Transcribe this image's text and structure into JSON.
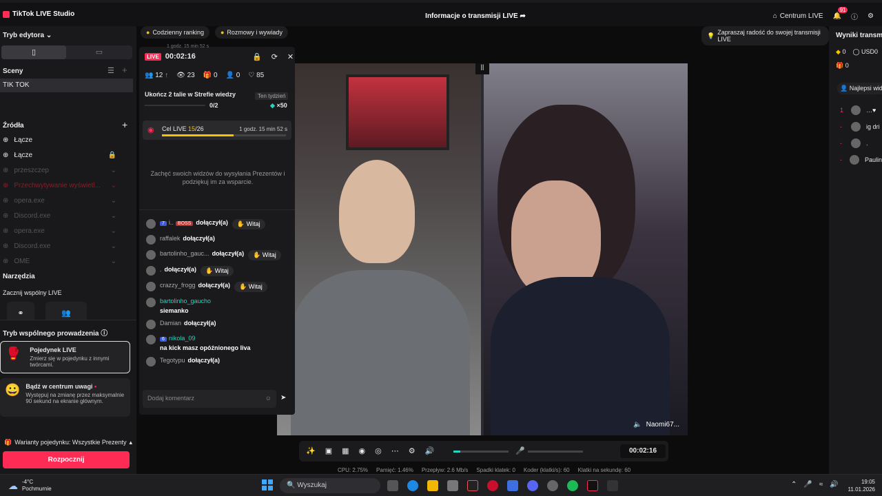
{
  "app": {
    "title": "TikTok LIVE Studio",
    "window_title": "Informacje o transmisji LIVE",
    "center_label": "Centrum LIVE",
    "notif_count": "91"
  },
  "left": {
    "mode_label": "Tryb edytora",
    "scenes_label": "Sceny",
    "scene": "TIK TOK",
    "sources_label": "Źródła",
    "sources": [
      {
        "label": "Łącze",
        "style": "on"
      },
      {
        "label": "Łącze",
        "style": "on"
      },
      {
        "label": "przeszczep",
        "style": "dim"
      },
      {
        "label": "Przechwytywanie wyświetl...",
        "style": "red"
      },
      {
        "label": "opera.exe",
        "style": "dim"
      },
      {
        "label": "Discord.exe",
        "style": "dim"
      },
      {
        "label": "opera.exe",
        "style": "dim"
      },
      {
        "label": "Discord.exe",
        "style": "dim"
      },
      {
        "label": "OME",
        "style": "dim"
      }
    ],
    "tools_label": "Narzędzia",
    "shared_label": "Zacznij wspólny LIVE",
    "coop_label": "Tryb wspólnego prowadzenia",
    "card1_title": "Pojedynek LIVE",
    "card1_desc": "Zmierz się w pojedynku z innymi twórcami.",
    "card2_title": "Bądź w centrum uwagi",
    "card2_desc": "Występuj na zmianę przez maksymalnie 90 sekund na ekranie głównym.",
    "variants": "Warianty pojedynku: Wszystkie Prezenty",
    "start": "Rozpocznij"
  },
  "center": {
    "chip1": "Codzienny ranking",
    "chip2": "Rozmowy i wywiady",
    "tip": "Zapraszaj radość do swojej transmisji LIVE",
    "streamer_name": "Naomi67...",
    "timer": "00:02:16"
  },
  "panel": {
    "live": "LIVE",
    "time": "00:02:16",
    "top_note": "1 godz. 15 min 52 s",
    "stats": {
      "viewers": "12",
      "views": "23",
      "gifts": "0",
      "shares": "0",
      "likes": "85"
    },
    "task": "Ukończ 2 talie w Strefie wiedzy",
    "task_tag": "Ten tydzień",
    "task_progress": "0/2",
    "task_reward": "×50",
    "task_fraction": 0.0,
    "goal_label": "Cel LIVE",
    "goal_done": "15",
    "goal_total": "/26",
    "goal_time": "1 godz. 15 min 52 s",
    "goal_fraction": 0.58,
    "encourage": "Zachęć swoich widzów do wysyłania Prezentów i podziękuj im za wsparcie.",
    "msgs": [
      {
        "name": "i..",
        "text": "dołączył(a)",
        "btn": "Witaj",
        "lvl": "7",
        "boss": "BOSS"
      },
      {
        "name": "raffalek",
        "text": "dołączył(a)",
        "btn": ""
      },
      {
        "name": "bartolinho_gauc...",
        "text": "dołączył(a)",
        "btn": "Witaj"
      },
      {
        "name": ".",
        "text": "dołączył(a)",
        "btn": "Witaj"
      },
      {
        "name": "crazzy_frogg",
        "text": "dołączył(a)",
        "btn": "Witaj"
      },
      {
        "name": "bartolinho_gaucho",
        "text": "siemanko",
        "btn": "",
        "comment": true
      },
      {
        "name": "Damian",
        "text": "dołączył(a)",
        "btn": ""
      },
      {
        "name": "nikola_09",
        "text": "na kick masz opóźnionego liva",
        "btn": "",
        "comment": true,
        "lvl": "6"
      },
      {
        "name": "Tegotypu",
        "text": "dołączył(a)",
        "btn": ""
      }
    ],
    "comment_placeholder": "Dodaj komentarz"
  },
  "status": {
    "cpu": "CPU: 2.75%",
    "mem": "Pamięć: 1.46%",
    "bitrate": "Przepływ: 2.6 Mb/s",
    "drops": "Spadki klatek: 0",
    "encoder": "Koder (klatki/s): 60",
    "fps": "Klatki na sekundę: 60"
  },
  "right": {
    "title": "Wyniki transmi",
    "coins": "0",
    "usd": "USD0",
    "gifts": "0",
    "best": "Najlepsi wid",
    "ranks": [
      {
        "rank": "1",
        "name": "…♥"
      },
      {
        "rank": "-",
        "name": "ig dri"
      },
      {
        "rank": "-",
        "name": "."
      },
      {
        "rank": "-",
        "name": "Paulin"
      }
    ]
  },
  "taskbar": {
    "temp": "-4°C",
    "weather": "Pochmurnie",
    "search": "Wyszukaj",
    "time": "19:05",
    "date": "11.01.2026"
  },
  "colors": {
    "accent": "#fe2c55",
    "goal": "#f5c400",
    "teal": "#24d5c0"
  }
}
